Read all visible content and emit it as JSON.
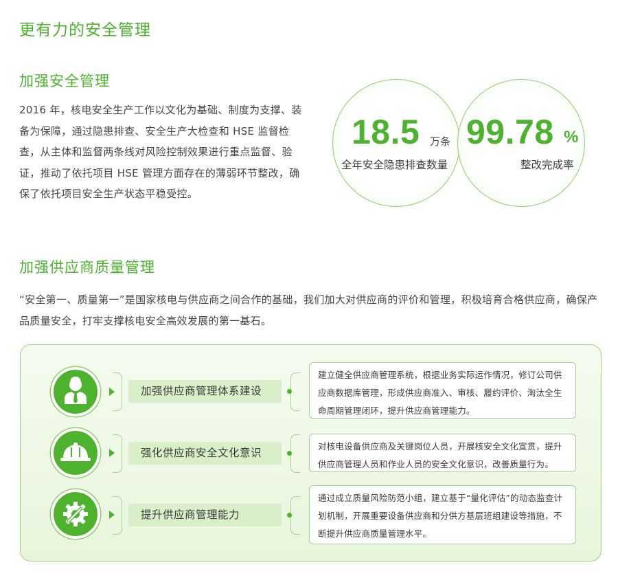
{
  "page": {
    "title": "更有力的安全管理"
  },
  "section1": {
    "title": "加强安全管理",
    "body": "2016 年，核电安全生产工作以文化为基础、制度为支撑、装备为保障，通过隐患排查、安全生产大检查和 HSE 监督检查，从主体和监督两条线对风险控制效果进行重点监督、验证，推动了依托项目 HSE 管理方面存在的薄弱环节整改，确保了依托项目安全生产状态平稳受控。"
  },
  "stats": [
    {
      "value": "18.5",
      "unit": "万条",
      "label": "全年安全隐患排查数量"
    },
    {
      "value": "99.78",
      "unit": "%",
      "label": "整改完成率"
    }
  ],
  "section2": {
    "title": "加强供应商质量管理",
    "body": "“安全第一、质量第一”是国家核电与供应商之间合作的基础，我们加大对供应商的评价和管理，积极培育合格供应商，确保产品质量安全，打牢支撑核电安全高效发展的第一基石。"
  },
  "items": [
    {
      "icon": "manager-icon",
      "label": "加强供应商管理体系建设",
      "desc": "建立健全供应商管理系统，根据业务实际运作情况，修订公司供应商数据库管理，形成供应商准入、审核、履约评价、淘汰全生命周期管理闭环，提升供应商管理能力。"
    },
    {
      "icon": "helmet-icon",
      "label": "强化供应商安全文化意识",
      "desc": "对核电设备供应商及关键岗位人员，开展核安全文化宣贯，提升供应商管理人员和作业人员的安全文化意识，改善质量行为。"
    },
    {
      "icon": "gear-wrench-icon",
      "label": "提升供应商管理能力",
      "desc": "通过成立质量风险防范小组，建立基于“量化评估”的动态监查计划机制，开展重要设备供应商和分供方基层班组建设等措施，不断提升供应商质量管理水平。"
    }
  ],
  "colors": {
    "accent": "#4db32e",
    "light": "#d9efc9",
    "border": "#a8cf92"
  }
}
